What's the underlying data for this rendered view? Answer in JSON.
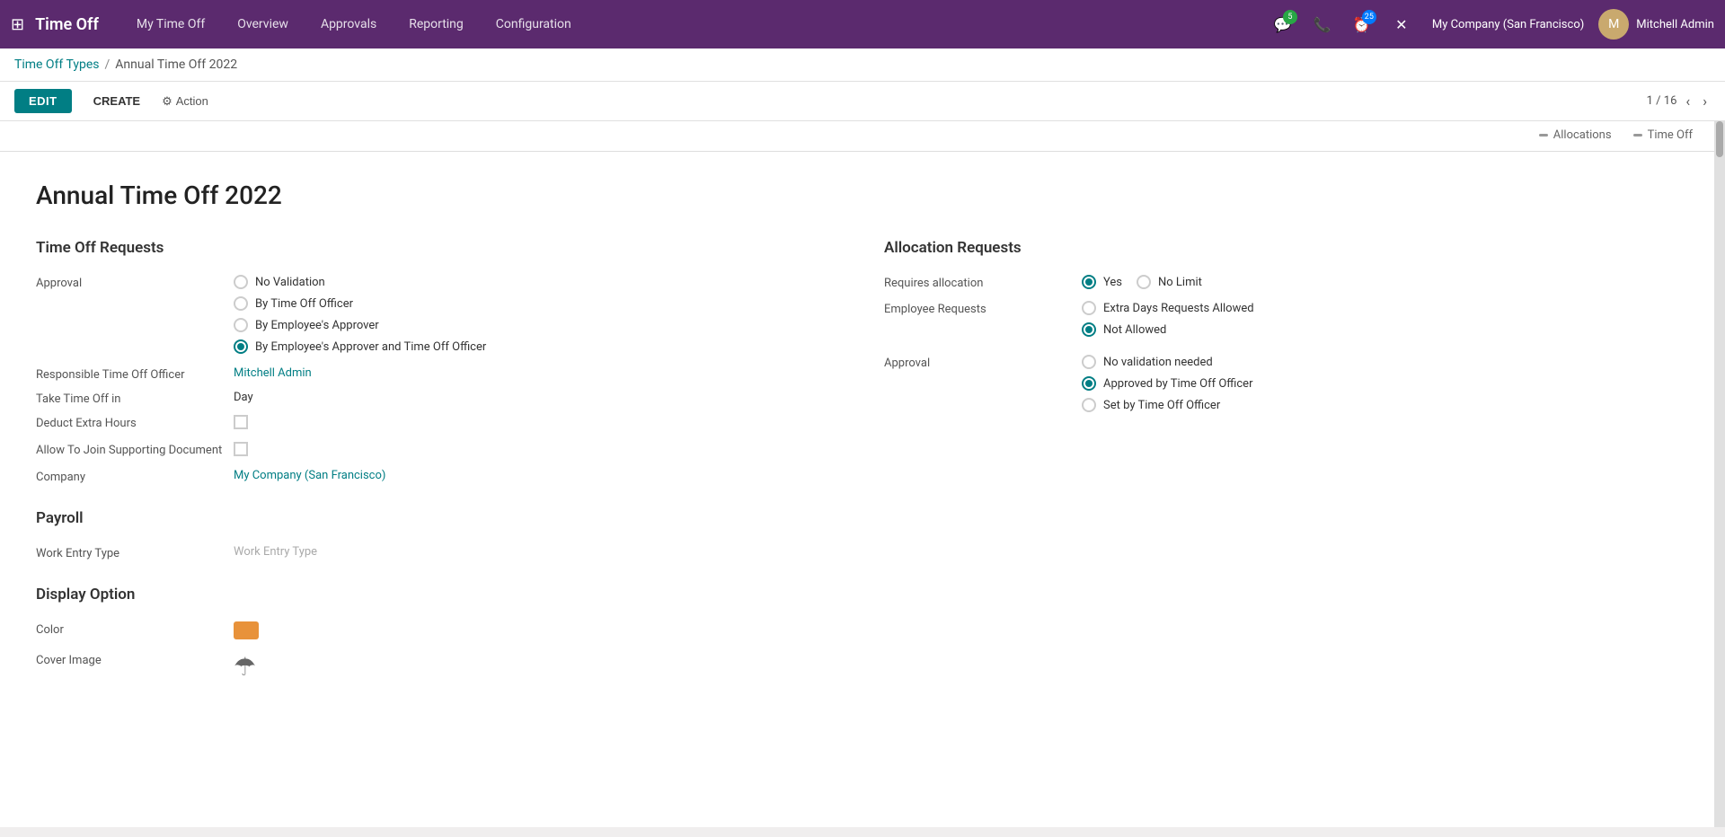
{
  "nav": {
    "brand": "Time Off",
    "apps_icon": "⊞",
    "links": [
      {
        "label": "My Time Off",
        "id": "my-time-off"
      },
      {
        "label": "Overview",
        "id": "overview"
      },
      {
        "label": "Approvals",
        "id": "approvals"
      },
      {
        "label": "Reporting",
        "id": "reporting"
      },
      {
        "label": "Configuration",
        "id": "configuration"
      }
    ],
    "icons": [
      {
        "name": "chat-icon",
        "symbol": "💬",
        "badge": "5",
        "badge_type": "green"
      },
      {
        "name": "phone-icon",
        "symbol": "📞",
        "badge": null
      },
      {
        "name": "clock-icon",
        "symbol": "⏰",
        "badge": "25",
        "badge_type": "blue"
      },
      {
        "name": "close-icon",
        "symbol": "✕",
        "badge": null
      }
    ],
    "company": "My Company (San Francisco)",
    "user": "Mitchell Admin",
    "avatar_initials": "M"
  },
  "breadcrumb": {
    "parent_label": "Time Off Types",
    "separator": "/",
    "current_label": "Annual Time Off 2022"
  },
  "toolbar": {
    "edit_label": "EDIT",
    "create_label": "CREATE",
    "action_label": "⚙ Action",
    "pagination": "1 / 16",
    "prev_arrow": "‹",
    "next_arrow": "›"
  },
  "tabs": [
    {
      "label": "Allocations",
      "id": "allocations-tab"
    },
    {
      "label": "Time Off",
      "id": "time-off-tab"
    }
  ],
  "form": {
    "title": "Annual Time Off 2022",
    "time_off_requests": {
      "section_title": "Time Off Requests",
      "approval_label": "Approval",
      "approval_options": [
        {
          "label": "No Validation",
          "checked": false
        },
        {
          "label": "By Time Off Officer",
          "checked": false
        },
        {
          "label": "By Employee's Approver",
          "checked": false
        },
        {
          "label": "By Employee's Approver and Time Off Officer",
          "checked": true
        }
      ],
      "responsible_label": "Responsible Time Off Officer",
      "responsible_value": "Mitchell Admin",
      "take_time_off_label": "Take Time Off in",
      "take_time_off_value": "Day",
      "deduct_label": "Deduct Extra Hours",
      "allow_label": "Allow To Join Supporting Document",
      "company_label": "Company",
      "company_value": "My Company (San Francisco)"
    },
    "allocation_requests": {
      "section_title": "Allocation Requests",
      "requires_label": "Requires allocation",
      "requires_options": [
        {
          "label": "Yes",
          "checked": true
        },
        {
          "label": "No Limit",
          "checked": false
        }
      ],
      "employee_requests_label": "Employee Requests",
      "employee_options": [
        {
          "label": "Extra Days Requests Allowed",
          "checked": false
        },
        {
          "label": "Not Allowed",
          "checked": true
        }
      ],
      "approval_label": "Approval",
      "approval_options": [
        {
          "label": "No validation needed",
          "checked": false
        },
        {
          "label": "Approved by Time Off Officer",
          "checked": true
        },
        {
          "label": "Set by Time Off Officer",
          "checked": false
        }
      ]
    },
    "payroll": {
      "section_title": "Payroll",
      "work_entry_label": "Work Entry Type",
      "work_entry_placeholder": "Work Entry Type"
    },
    "display_option": {
      "section_title": "Display Option",
      "color_label": "Color",
      "cover_image_label": "Cover Image",
      "color_hex": "#e8923a"
    }
  }
}
